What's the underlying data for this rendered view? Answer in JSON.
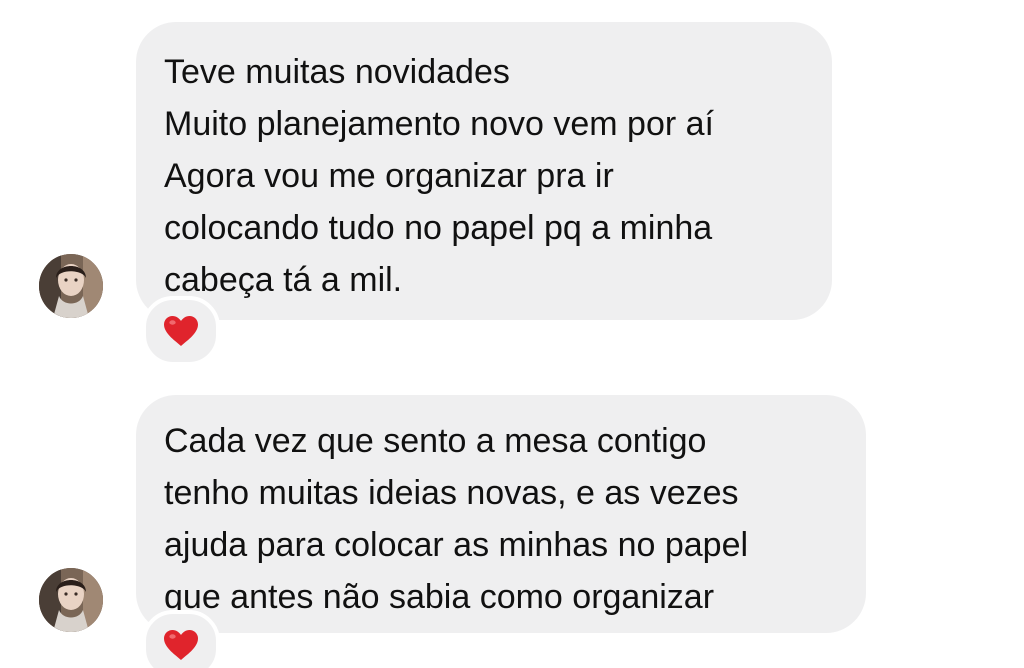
{
  "messages": [
    {
      "lines": [
        "Teve muitas novidades",
        "Muito planejamento novo vem por aí",
        "Agora vou me organizar pra ir",
        "colocando tudo no papel pq a minha",
        "cabeça tá a mil."
      ],
      "reaction": "red-heart",
      "reaction_color": "#e0242c"
    },
    {
      "lines": [
        "Cada vez que sento a mesa contigo",
        "tenho muitas ideias novas, e as vezes",
        "ajuda para colocar as minhas no papel",
        "que antes não sabia como organizar"
      ],
      "reaction": "red-heart",
      "reaction_color": "#e0242c"
    }
  ],
  "colors": {
    "bubble_background": "#efeff0",
    "text": "#111111",
    "page_background": "#ffffff"
  }
}
